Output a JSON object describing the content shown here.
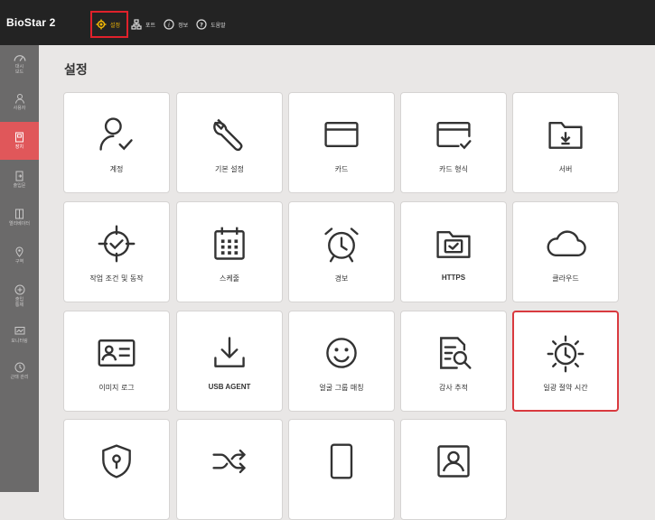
{
  "app": {
    "title": "BioStar 2"
  },
  "topnav": {
    "settings_label": "설정",
    "port_label": "포트",
    "info_label": "정보",
    "help_label": "도움말"
  },
  "sidebar": {
    "items": [
      {
        "label": "대시\n보드",
        "icon": "dashboard-gauge-icon"
      },
      {
        "label": "사용자",
        "icon": "user-icon"
      },
      {
        "label": "장치",
        "icon": "device-icon"
      },
      {
        "label": "출입문",
        "icon": "door-icon"
      },
      {
        "label": "엘리베이터",
        "icon": "elevator-icon"
      },
      {
        "label": "구역",
        "icon": "zone-icon"
      },
      {
        "label": "출입\n통제",
        "icon": "access-control-icon"
      },
      {
        "label": "모니터링",
        "icon": "monitoring-icon"
      },
      {
        "label": "근태 관리",
        "icon": "clock-icon"
      }
    ],
    "active_index": 2
  },
  "page": {
    "title": "설정"
  },
  "tiles": [
    {
      "label": "계정",
      "icon": "account-user-icon"
    },
    {
      "label": "기본 설정",
      "icon": "wrench-icon"
    },
    {
      "label": "카드",
      "icon": "card-icon"
    },
    {
      "label": "카드 형식",
      "icon": "card-format-icon"
    },
    {
      "label": "서버",
      "icon": "server-folder-icon"
    },
    {
      "label": "작업 조건 및 동작",
      "icon": "trigger-action-icon"
    },
    {
      "label": "스케줄",
      "icon": "calendar-icon"
    },
    {
      "label": "경보",
      "icon": "alarm-clock-icon"
    },
    {
      "label": "HTTPS",
      "icon": "https-folder-icon"
    },
    {
      "label": "클라우드",
      "icon": "cloud-icon"
    },
    {
      "label": "이미지 로그",
      "icon": "image-log-icon"
    },
    {
      "label": "USB AGENT",
      "icon": "usb-download-icon"
    },
    {
      "label": "얼굴 그룹 매칭",
      "icon": "smiley-face-icon"
    },
    {
      "label": "감사 추적",
      "icon": "audit-search-icon"
    },
    {
      "label": "일광 절약 시간",
      "icon": "daylight-saving-icon"
    },
    {
      "label": "",
      "icon": "security-shield-icon"
    },
    {
      "label": "",
      "icon": "shuffle-icon"
    },
    {
      "label": "",
      "icon": "mobile-device-icon"
    },
    {
      "label": "",
      "icon": "visual-face-icon"
    }
  ],
  "selected_tile_index": 14,
  "colors": {
    "topbar": "#232323",
    "sidebar": "#6b6a6a",
    "sidebar_active": "#e0575a",
    "highlight": "#e0212b",
    "accent_yellow": "#f2b705",
    "content_bg": "#e9e7e6"
  }
}
